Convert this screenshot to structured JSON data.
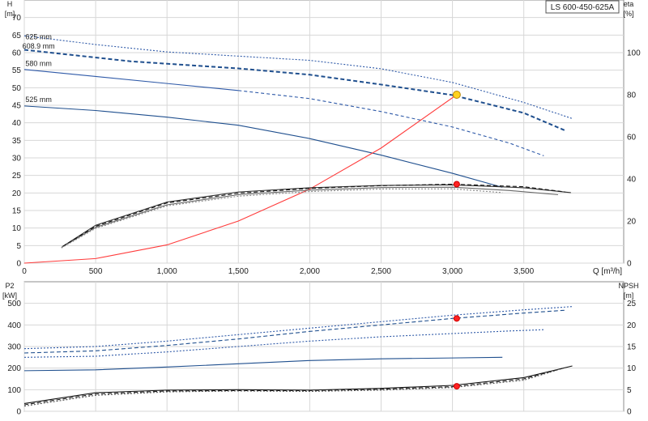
{
  "chart_data": [
    {
      "type": "line",
      "panel": "top",
      "title": "LS 600-450-625A",
      "xlabel": "Q [m³/h]",
      "ylabel_left": [
        "H",
        "[m]"
      ],
      "ylabel_right": [
        "eta",
        "[%]"
      ],
      "grid": true,
      "xlim": [
        0,
        4200
      ],
      "ylim_left": [
        0,
        75
      ],
      "ylim_right": [
        0,
        125
      ],
      "x_ticks": [
        {
          "value": 0,
          "label": "0"
        },
        {
          "value": 500,
          "label": "500"
        },
        {
          "value": 1000,
          "label": "1,000"
        },
        {
          "value": 1500,
          "label": "1,500"
        },
        {
          "value": 2000,
          "label": "2,000"
        },
        {
          "value": 2500,
          "label": "2,500"
        },
        {
          "value": 3000,
          "label": "3,000"
        },
        {
          "value": 3500,
          "label": "3,500"
        }
      ],
      "y_left_ticks": [
        {
          "value": 0,
          "label": "0"
        },
        {
          "value": 5,
          "label": "5"
        },
        {
          "value": 10,
          "label": "10"
        },
        {
          "value": 15,
          "label": "15"
        },
        {
          "value": 20,
          "label": "20"
        },
        {
          "value": 25,
          "label": "25"
        },
        {
          "value": 30,
          "label": "30"
        },
        {
          "value": 35,
          "label": "35"
        },
        {
          "value": 40,
          "label": "40"
        },
        {
          "value": 45,
          "label": "45"
        },
        {
          "value": 50,
          "label": "50"
        },
        {
          "value": 55,
          "label": "55"
        },
        {
          "value": 60,
          "label": "60"
        },
        {
          "value": 65,
          "label": "65"
        },
        {
          "value": 70,
          "label": "70"
        }
      ],
      "y_right_ticks": [
        {
          "value": 0,
          "label": "0"
        },
        {
          "value": 20,
          "label": "20"
        },
        {
          "value": 40,
          "label": "40"
        },
        {
          "value": 60,
          "label": "60"
        },
        {
          "value": 80,
          "label": "80"
        },
        {
          "value": 100,
          "label": "100"
        }
      ],
      "series": [
        {
          "name": "625 mm",
          "axis": "left",
          "style": "dotted",
          "color": "#2f5aa8",
          "label_at": [
            100,
            63.8
          ],
          "points": [
            [
              0,
              64.8
            ],
            [
              500,
              62.3
            ],
            [
              1000,
              60.2
            ],
            [
              1500,
              59
            ],
            [
              2000,
              57.8
            ],
            [
              2500,
              55.4
            ],
            [
              3000,
              51.5
            ],
            [
              3500,
              45.8
            ],
            [
              3840,
              41.2
            ]
          ]
        },
        {
          "name": "608.9 mm",
          "axis": "left",
          "style": "dashed",
          "color": "#1f4f8e",
          "label_at": [
            100,
            61.2
          ],
          "points": [
            [
              0,
              60.8
            ],
            [
              750,
              57.5
            ],
            [
              1500,
              55.5
            ],
            [
              2000,
              53.7
            ],
            [
              2500,
              50.9
            ],
            [
              3000,
              47.9
            ],
            [
              3500,
              42.8
            ],
            [
              3790,
              37.8
            ]
          ]
        },
        {
          "name": "580 mm",
          "axis": "left",
          "style": "solid-then-dashed",
          "solid_until": 1500,
          "color": "#2f5aa8",
          "label_at": [
            100,
            56.2
          ],
          "points": [
            [
              0,
              55.2
            ],
            [
              500,
              53.2
            ],
            [
              1000,
              51.2
            ],
            [
              1500,
              49.2
            ],
            [
              2000,
              46.9
            ],
            [
              2500,
              43.2
            ],
            [
              3000,
              38.8
            ],
            [
              3400,
              34.2
            ],
            [
              3640,
              30.6
            ]
          ]
        },
        {
          "name": "525 mm",
          "axis": "left",
          "style": "solid",
          "color": "#1f4f8e",
          "label_at": [
            100,
            45.9
          ],
          "points": [
            [
              0,
              44.8
            ],
            [
              500,
              43.5
            ],
            [
              1000,
              41.6
            ],
            [
              1500,
              39.3
            ],
            [
              2000,
              35.5
            ],
            [
              2500,
              30.8
            ],
            [
              3000,
              25.6
            ],
            [
              3350,
              21.6
            ]
          ]
        },
        {
          "name": "",
          "axis": "left",
          "style": "solid",
          "color": "#ff3b3b",
          "points": [
            [
              0,
              0
            ],
            [
              500,
              1.3
            ],
            [
              1000,
              5.2
            ],
            [
              1500,
              12
            ],
            [
              2000,
              21.1
            ],
            [
              2500,
              32.8
            ],
            [
              3030,
              48
            ]
          ]
        },
        {
          "name": "",
          "axis": "right",
          "style": "solid",
          "color": "#333333",
          "points": [
            [
              270,
              8
            ],
            [
              500,
              18
            ],
            [
              1000,
              29
            ],
            [
              1500,
              33.8
            ],
            [
              2000,
              35.8
            ],
            [
              2500,
              36.9
            ],
            [
              3000,
              37.2
            ],
            [
              3500,
              35.8
            ],
            [
              3830,
              33.5
            ]
          ]
        },
        {
          "name": "",
          "axis": "right",
          "style": "solid",
          "color": "#666666",
          "points": [
            [
              260,
              7.5
            ],
            [
              500,
              17
            ],
            [
              1000,
              27.7
            ],
            [
              1500,
              32.5
            ],
            [
              2000,
              34.7
            ],
            [
              2500,
              35.9
            ],
            [
              3000,
              36.1
            ],
            [
              3400,
              34.5
            ],
            [
              3740,
              32.5
            ]
          ]
        },
        {
          "name": "",
          "axis": "right",
          "style": "dashed",
          "color": "#111111",
          "points": [
            [
              270,
              8
            ],
            [
              500,
              17.5
            ],
            [
              1000,
              28.6
            ],
            [
              1500,
              33.2
            ],
            [
              2000,
              35.5
            ],
            [
              2500,
              36.8
            ],
            [
              3000,
              37.5
            ],
            [
              3500,
              36.3
            ],
            [
              3790,
              33.8
            ]
          ]
        },
        {
          "name": "",
          "axis": "right",
          "style": "dotted",
          "color": "#888888",
          "points": [
            [
              260,
              7.2
            ],
            [
              500,
              16.5
            ],
            [
              1000,
              27.2
            ],
            [
              1500,
              31.8
            ],
            [
              2000,
              34
            ],
            [
              2500,
              35.2
            ],
            [
              3000,
              35.3
            ],
            [
              3350,
              33.5
            ]
          ]
        }
      ],
      "markers": [
        {
          "x": 3030,
          "y": 48,
          "axis": "left",
          "color": "#ffd21f",
          "stroke": "#b8860b"
        },
        {
          "x": 3030,
          "y": 37.5,
          "axis": "right",
          "color": "#ff2222",
          "stroke": "#cc0000"
        }
      ]
    },
    {
      "type": "line",
      "panel": "bottom",
      "title": "",
      "xlabel": "",
      "ylabel_left": [
        "P2",
        "[kW]"
      ],
      "ylabel_right": [
        "NPSH",
        "[m]"
      ],
      "grid": true,
      "xlim": [
        0,
        4200
      ],
      "ylim_left": [
        0,
        600
      ],
      "ylim_right": [
        0,
        30
      ],
      "x_ticks": [
        {
          "value": 0,
          "label": ""
        },
        {
          "value": 500,
          "label": ""
        },
        {
          "value": 1000,
          "label": ""
        },
        {
          "value": 1500,
          "label": ""
        },
        {
          "value": 2000,
          "label": ""
        },
        {
          "value": 2500,
          "label": ""
        },
        {
          "value": 3000,
          "label": ""
        },
        {
          "value": 3500,
          "label": ""
        }
      ],
      "y_left_ticks": [
        {
          "value": 0,
          "label": "0"
        },
        {
          "value": 100,
          "label": "100"
        },
        {
          "value": 200,
          "label": "200"
        },
        {
          "value": 300,
          "label": "300"
        },
        {
          "value": 400,
          "label": "400"
        },
        {
          "value": 500,
          "label": "500"
        }
      ],
      "y_right_ticks": [
        {
          "value": 0,
          "label": "0"
        },
        {
          "value": 5,
          "label": "5"
        },
        {
          "value": 10,
          "label": "10"
        },
        {
          "value": 15,
          "label": "15"
        },
        {
          "value": 20,
          "label": "20"
        },
        {
          "value": 25,
          "label": "25"
        }
      ],
      "series": [
        {
          "name": "",
          "axis": "left",
          "style": "dotted",
          "color": "#2f5aa8",
          "points": [
            [
              0,
              290
            ],
            [
              500,
              300
            ],
            [
              1000,
              325
            ],
            [
              1500,
              355
            ],
            [
              2000,
              385
            ],
            [
              2500,
              415
            ],
            [
              3000,
              445
            ],
            [
              3500,
              470
            ],
            [
              3840,
              485
            ]
          ]
        },
        {
          "name": "",
          "axis": "left",
          "style": "dashed",
          "color": "#1f4f8e",
          "points": [
            [
              0,
              270
            ],
            [
              500,
              280
            ],
            [
              1000,
              305
            ],
            [
              1500,
              335
            ],
            [
              2000,
              370
            ],
            [
              2500,
              400
            ],
            [
              3000,
              430
            ],
            [
              3500,
              455
            ],
            [
              3790,
              468
            ]
          ]
        },
        {
          "name": "",
          "axis": "left",
          "style": "dotted",
          "color": "#2f5aa8",
          "points": [
            [
              0,
              250
            ],
            [
              500,
              255
            ],
            [
              1000,
              275
            ],
            [
              1500,
              300
            ],
            [
              2000,
              325
            ],
            [
              2500,
              345
            ],
            [
              3000,
              360
            ],
            [
              3400,
              372
            ],
            [
              3640,
              378
            ]
          ]
        },
        {
          "name": "",
          "axis": "left",
          "style": "solid",
          "color": "#1f4f8e",
          "points": [
            [
              0,
              188
            ],
            [
              500,
              192
            ],
            [
              1000,
              205
            ],
            [
              1500,
              220
            ],
            [
              2000,
              235
            ],
            [
              2500,
              243
            ],
            [
              3000,
              247
            ],
            [
              3350,
              250
            ]
          ]
        },
        {
          "name": "",
          "axis": "right",
          "style": "solid",
          "color": "#111111",
          "points": [
            [
              0,
              1.8
            ],
            [
              500,
              4.3
            ],
            [
              1000,
              4.9
            ],
            [
              1500,
              5
            ],
            [
              2000,
              4.9
            ],
            [
              2500,
              5.3
            ],
            [
              3000,
              6
            ],
            [
              3500,
              7.8
            ],
            [
              3840,
              10.5
            ]
          ]
        },
        {
          "name": "",
          "axis": "right",
          "style": "dashed",
          "color": "#222222",
          "points": [
            [
              0,
              1.5
            ],
            [
              500,
              4
            ],
            [
              1000,
              4.7
            ],
            [
              1500,
              4.8
            ],
            [
              2000,
              4.8
            ],
            [
              2500,
              5.1
            ],
            [
              3000,
              5.7
            ],
            [
              3500,
              7.5
            ],
            [
              3790,
              10.1
            ]
          ]
        },
        {
          "name": "",
          "axis": "right",
          "style": "dotted",
          "color": "#555555",
          "points": [
            [
              0,
              1.2
            ],
            [
              500,
              3.7
            ],
            [
              1000,
              4.5
            ],
            [
              1500,
              4.7
            ],
            [
              2000,
              4.6
            ],
            [
              2500,
              4.9
            ],
            [
              3000,
              5.5
            ],
            [
              3500,
              7.2
            ],
            [
              3740,
              9.6
            ]
          ]
        }
      ],
      "markers": [
        {
          "x": 3030,
          "y": 430,
          "axis": "left",
          "color": "#ff2222",
          "stroke": "#cc0000"
        },
        {
          "x": 3030,
          "y": 5.8,
          "axis": "right",
          "color": "#ff2222",
          "stroke": "#cc0000"
        }
      ]
    }
  ]
}
